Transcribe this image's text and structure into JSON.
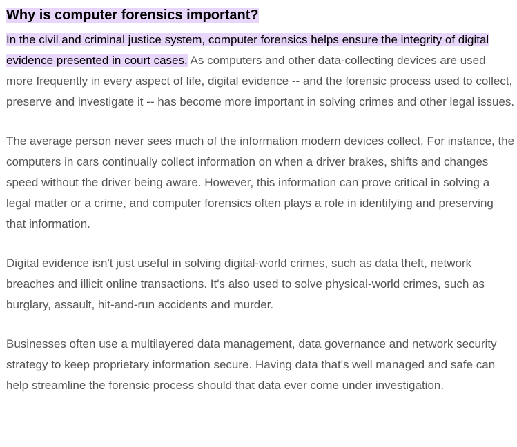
{
  "article": {
    "heading": "Why is computer forensics important?",
    "highlight_color": "#e8d5fa",
    "paragraphs": [
      {
        "highlighted": "In the civil and criminal justice system, computer forensics helps ensure the integrity of digital evidence presented in court cases.",
        "text": " As computers and other data-collecting devices are used more frequently in every aspect of life, digital evidence -- and the forensic process used to collect, preserve and investigate it -- has become more important in solving crimes and other legal issues."
      },
      {
        "text": "The average person never sees much of the information modern devices collect. For instance, the computers in cars continually collect information on when a driver brakes, shifts and changes speed without the driver being aware. However, this information can prove critical in solving a legal matter or a crime, and computer forensics often plays a role in identifying and preserving that information."
      },
      {
        "text": "Digital evidence isn't just useful in solving digital-world crimes, such as data theft, network breaches and illicit online transactions. It's also used to solve physical-world crimes, such as burglary, assault, hit-and-run accidents and murder."
      },
      {
        "text": "Businesses often use a multilayered data management, data governance and network security strategy to keep proprietary information secure. Having data that's well managed and safe can help streamline the forensic process should that data ever come under investigation."
      }
    ]
  }
}
